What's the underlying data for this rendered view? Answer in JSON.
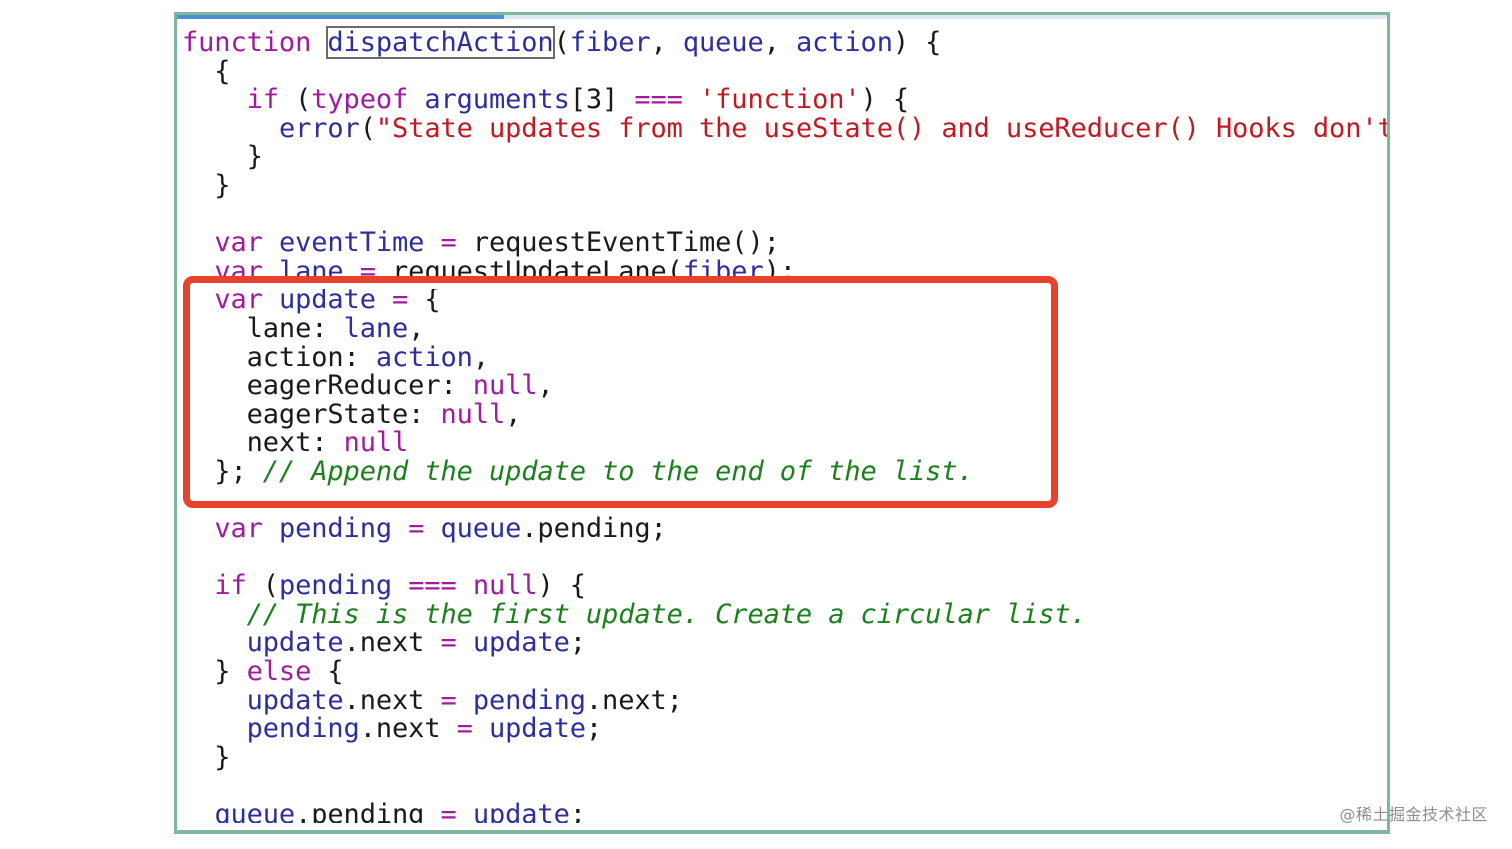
{
  "code": {
    "lines": [
      [
        {
          "t": "kw",
          "v": "function"
        },
        {
          "t": "plain",
          "v": " "
        },
        {
          "t": "fn",
          "v": "dispatchAction",
          "box": true
        },
        {
          "t": "plain",
          "v": "("
        },
        {
          "t": "fn",
          "v": "fiber"
        },
        {
          "t": "plain",
          "v": ", "
        },
        {
          "t": "fn",
          "v": "queue"
        },
        {
          "t": "plain",
          "v": ", "
        },
        {
          "t": "fn",
          "v": "action"
        },
        {
          "t": "plain",
          "v": ") {"
        }
      ],
      [
        {
          "t": "plain",
          "v": "  {"
        }
      ],
      [
        {
          "t": "plain",
          "v": "    "
        },
        {
          "t": "kw",
          "v": "if"
        },
        {
          "t": "plain",
          "v": " ("
        },
        {
          "t": "kw",
          "v": "typeof"
        },
        {
          "t": "plain",
          "v": " "
        },
        {
          "t": "fn",
          "v": "arguments"
        },
        {
          "t": "plain",
          "v": "[3] "
        },
        {
          "t": "kw",
          "v": "==="
        },
        {
          "t": "plain",
          "v": " "
        },
        {
          "t": "str",
          "v": "'function'"
        },
        {
          "t": "plain",
          "v": ") {"
        }
      ],
      [
        {
          "t": "plain",
          "v": "      "
        },
        {
          "t": "fn",
          "v": "error"
        },
        {
          "t": "plain",
          "v": "("
        },
        {
          "t": "str",
          "v": "\"State updates from the useState() and useReducer() Hooks don't"
        }
      ],
      [
        {
          "t": "plain",
          "v": "    }"
        }
      ],
      [
        {
          "t": "plain",
          "v": "  }"
        }
      ],
      [
        {
          "t": "plain",
          "v": ""
        }
      ],
      [
        {
          "t": "plain",
          "v": "  "
        },
        {
          "t": "kw",
          "v": "var"
        },
        {
          "t": "plain",
          "v": " "
        },
        {
          "t": "fn",
          "v": "eventTime"
        },
        {
          "t": "plain",
          "v": " "
        },
        {
          "t": "kw",
          "v": "="
        },
        {
          "t": "plain",
          "v": " requestEventTime();"
        }
      ],
      [
        {
          "t": "plain",
          "v": "  "
        },
        {
          "t": "kw",
          "v": "var"
        },
        {
          "t": "plain",
          "v": " "
        },
        {
          "t": "fn",
          "v": "lane"
        },
        {
          "t": "plain",
          "v": " "
        },
        {
          "t": "kw",
          "v": "="
        },
        {
          "t": "plain",
          "v": " requestUpdateLane("
        },
        {
          "t": "fn",
          "v": "fiber"
        },
        {
          "t": "plain",
          "v": ");"
        }
      ],
      [
        {
          "t": "plain",
          "v": "  "
        },
        {
          "t": "kw",
          "v": "var"
        },
        {
          "t": "plain",
          "v": " "
        },
        {
          "t": "fn",
          "v": "update"
        },
        {
          "t": "plain",
          "v": " "
        },
        {
          "t": "kw",
          "v": "="
        },
        {
          "t": "plain",
          "v": " {"
        }
      ],
      [
        {
          "t": "plain",
          "v": "    lane: "
        },
        {
          "t": "fn",
          "v": "lane"
        },
        {
          "t": "plain",
          "v": ","
        }
      ],
      [
        {
          "t": "plain",
          "v": "    action: "
        },
        {
          "t": "fn",
          "v": "action"
        },
        {
          "t": "plain",
          "v": ","
        }
      ],
      [
        {
          "t": "plain",
          "v": "    eagerReducer: "
        },
        {
          "t": "kw",
          "v": "null"
        },
        {
          "t": "plain",
          "v": ","
        }
      ],
      [
        {
          "t": "plain",
          "v": "    eagerState: "
        },
        {
          "t": "kw",
          "v": "null"
        },
        {
          "t": "plain",
          "v": ","
        }
      ],
      [
        {
          "t": "plain",
          "v": "    next: "
        },
        {
          "t": "kw",
          "v": "null"
        }
      ],
      [
        {
          "t": "plain",
          "v": "  }; "
        },
        {
          "t": "cmt",
          "v": "// Append the update to the end of the list."
        }
      ],
      [
        {
          "t": "plain",
          "v": ""
        }
      ],
      [
        {
          "t": "plain",
          "v": "  "
        },
        {
          "t": "kw",
          "v": "var"
        },
        {
          "t": "plain",
          "v": " "
        },
        {
          "t": "fn",
          "v": "pending"
        },
        {
          "t": "plain",
          "v": " "
        },
        {
          "t": "kw",
          "v": "="
        },
        {
          "t": "plain",
          "v": " "
        },
        {
          "t": "fn",
          "v": "queue"
        },
        {
          "t": "plain",
          "v": ".pending;"
        }
      ],
      [
        {
          "t": "plain",
          "v": ""
        }
      ],
      [
        {
          "t": "plain",
          "v": "  "
        },
        {
          "t": "kw",
          "v": "if"
        },
        {
          "t": "plain",
          "v": " ("
        },
        {
          "t": "fn",
          "v": "pending"
        },
        {
          "t": "plain",
          "v": " "
        },
        {
          "t": "kw",
          "v": "==="
        },
        {
          "t": "plain",
          "v": " "
        },
        {
          "t": "kw",
          "v": "null"
        },
        {
          "t": "plain",
          "v": ") {"
        }
      ],
      [
        {
          "t": "plain",
          "v": "    "
        },
        {
          "t": "cmt",
          "v": "// This is the first update. Create a circular list."
        }
      ],
      [
        {
          "t": "plain",
          "v": "    "
        },
        {
          "t": "fn",
          "v": "update"
        },
        {
          "t": "plain",
          "v": ".next "
        },
        {
          "t": "kw",
          "v": "="
        },
        {
          "t": "plain",
          "v": " "
        },
        {
          "t": "fn",
          "v": "update"
        },
        {
          "t": "plain",
          "v": ";"
        }
      ],
      [
        {
          "t": "plain",
          "v": "  } "
        },
        {
          "t": "kw",
          "v": "else"
        },
        {
          "t": "plain",
          "v": " {"
        }
      ],
      [
        {
          "t": "plain",
          "v": "    "
        },
        {
          "t": "fn",
          "v": "update"
        },
        {
          "t": "plain",
          "v": ".next "
        },
        {
          "t": "kw",
          "v": "="
        },
        {
          "t": "plain",
          "v": " "
        },
        {
          "t": "fn",
          "v": "pending"
        },
        {
          "t": "plain",
          "v": ".next;"
        }
      ],
      [
        {
          "t": "plain",
          "v": "    "
        },
        {
          "t": "fn",
          "v": "pending"
        },
        {
          "t": "plain",
          "v": ".next "
        },
        {
          "t": "kw",
          "v": "="
        },
        {
          "t": "plain",
          "v": " "
        },
        {
          "t": "fn",
          "v": "update"
        },
        {
          "t": "plain",
          "v": ";"
        }
      ],
      [
        {
          "t": "plain",
          "v": "  }"
        }
      ],
      [
        {
          "t": "plain",
          "v": ""
        }
      ],
      [
        {
          "t": "plain",
          "v": "  "
        },
        {
          "t": "fn",
          "v": "queue"
        },
        {
          "t": "plain",
          "v": ".pending "
        },
        {
          "t": "kw",
          "v": "="
        },
        {
          "t": "plain",
          "v": " "
        },
        {
          "t": "fn",
          "v": "update"
        },
        {
          "t": "plain",
          "v": ";"
        }
      ]
    ]
  },
  "scroll_progress": 0.27,
  "colors": {
    "keyword": "#a21b9e",
    "identifier": "#2c2f9c",
    "string": "#c01b23",
    "comment": "#1d7f1d",
    "frame_border": "#7fb79c",
    "highlight_border": "#e9412b"
  },
  "watermark": "@稀土掘金技术社区"
}
